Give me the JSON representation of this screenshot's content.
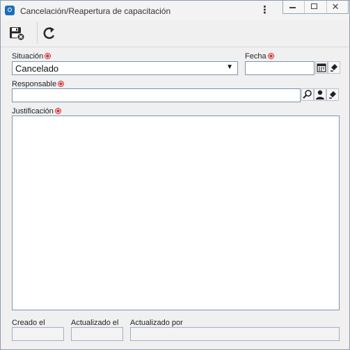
{
  "window": {
    "title": "Cancelación/Reapertura de capacitación",
    "menu_icon": "kebab-menu-icon",
    "controls": [
      "minimize-icon",
      "restore-icon",
      "close-icon"
    ]
  },
  "toolbar": {
    "save_exit_icon": "save-exit-icon",
    "refresh_icon": "refresh-icon"
  },
  "form": {
    "situacion": {
      "label": "Situación",
      "value": "Cancelado"
    },
    "fecha": {
      "label": "Fecha",
      "value": ""
    },
    "responsable": {
      "label": "Responsable",
      "value": ""
    },
    "justificacion": {
      "label": "Justificación",
      "value": ""
    },
    "creado_el": {
      "label": "Creado el",
      "value": ""
    },
    "actualizado_el": {
      "label": "Actualizado el",
      "value": ""
    },
    "actualizado_por": {
      "label": "Actualizado por",
      "value": ""
    }
  },
  "colors": {
    "border": "#7d93b1",
    "required": "#d42a2a",
    "icon_blue": "#1c6fb8"
  }
}
